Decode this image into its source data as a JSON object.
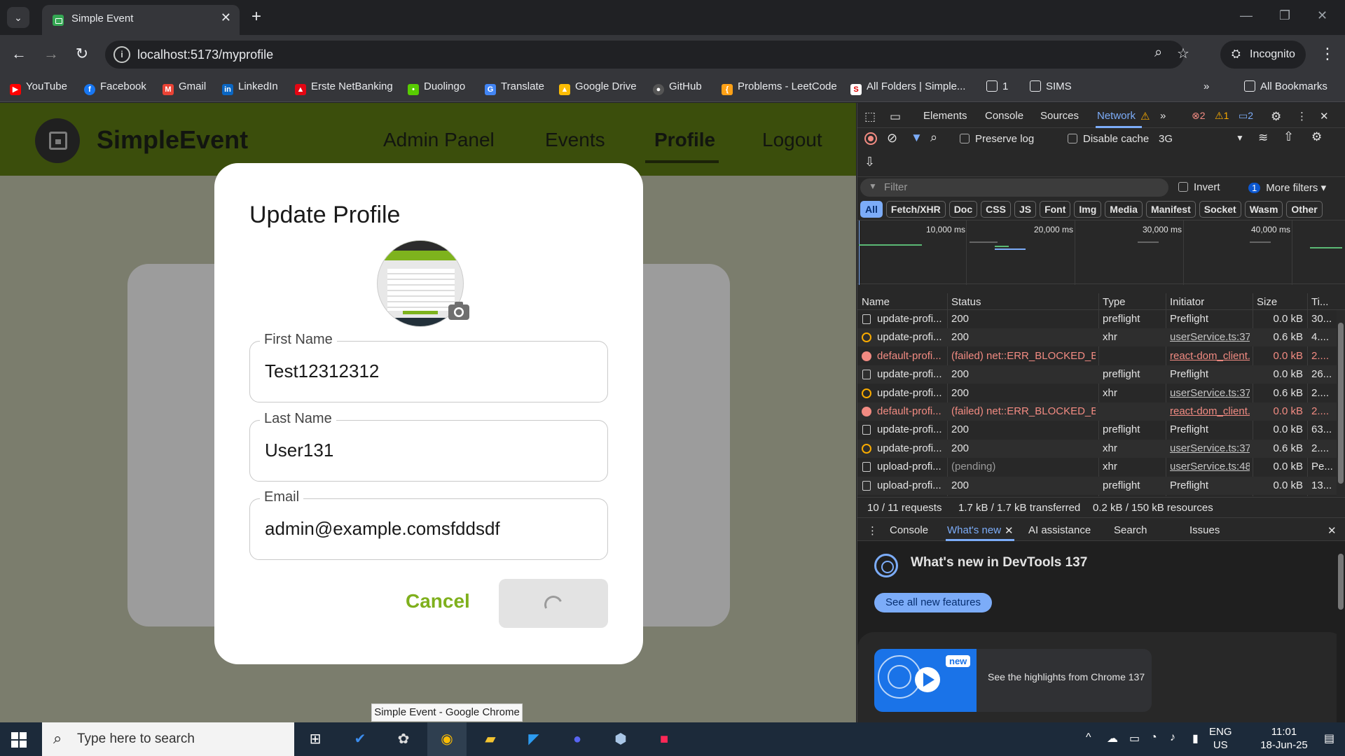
{
  "browser": {
    "tab_title": "Simple Event",
    "url": "localhost:5173/myprofile",
    "incognito_label": "Incognito",
    "bookmarks": [
      "YouTube",
      "Facebook",
      "Gmail",
      "LinkedIn",
      "Erste NetBanking",
      "Duolingo",
      "Translate",
      "Google Drive",
      "GitHub",
      "Problems - LeetCode",
      "All Folders | Simple...",
      "1",
      "SIMS"
    ],
    "all_bookmarks": "All Bookmarks"
  },
  "app": {
    "brand": "SimpleEvent",
    "nav": [
      "Admin Panel",
      "Events",
      "Profile",
      "Logout"
    ],
    "active_nav": "Profile",
    "accent_color": "#7fb01d",
    "header_color": "#3b4e0c"
  },
  "modal": {
    "title": "Update Profile",
    "first_name_label": "First Name",
    "first_name_value": "Test12312312",
    "last_name_label": "Last Name",
    "last_name_value": "User131",
    "email_label": "Email",
    "email_value": "admin@example.comsfddsdf",
    "cancel_label": "Cancel",
    "save_state": "loading"
  },
  "tooltip": "Simple Event - Google Chrome",
  "devtools": {
    "tabs": [
      "Elements",
      "Console",
      "Sources",
      "Network"
    ],
    "active_tab": "Network",
    "errors": "2",
    "warnings": "1",
    "info": "2",
    "preserve_log": "Preserve log",
    "disable_cache": "Disable cache",
    "throttle": "3G",
    "filter_placeholder": "Filter",
    "invert": "Invert",
    "more_filters_count": "1",
    "more_filters": "More filters",
    "type_filters": [
      "All",
      "Fetch/XHR",
      "Doc",
      "CSS",
      "JS",
      "Font",
      "Img",
      "Media",
      "Manifest",
      "Socket",
      "Wasm",
      "Other"
    ],
    "timeline_labels": [
      "10,000 ms",
      "20,000 ms",
      "30,000 ms",
      "40,000 ms"
    ],
    "columns": [
      "Name",
      "Status",
      "Type",
      "Initiator",
      "Size",
      "Ti..."
    ],
    "rows": [
      {
        "icon": "doc",
        "name": "update-profi...",
        "status": "200",
        "type": "preflight",
        "initiator": "Preflight",
        "size": "0.0 kB",
        "time": "30..."
      },
      {
        "icon": "xhr",
        "name": "update-profi...",
        "status": "200",
        "type": "xhr",
        "initiator": "userService.ts:37",
        "size": "0.6 kB",
        "time": "4...."
      },
      {
        "icon": "error",
        "name": "default-profi...",
        "status": "(failed) net::ERR_BLOCKED_B...",
        "type": "",
        "initiator": "react-dom_client.j",
        "size": "0.0 kB",
        "time": "2...."
      },
      {
        "icon": "doc",
        "name": "update-profi...",
        "status": "200",
        "type": "preflight",
        "initiator": "Preflight",
        "size": "0.0 kB",
        "time": "26..."
      },
      {
        "icon": "xhr",
        "name": "update-profi...",
        "status": "200",
        "type": "xhr",
        "initiator": "userService.ts:37",
        "size": "0.6 kB",
        "time": "2...."
      },
      {
        "icon": "error",
        "name": "default-profi...",
        "status": "(failed) net::ERR_BLOCKED_B...",
        "type": "",
        "initiator": "react-dom_client.j",
        "size": "0.0 kB",
        "time": "2...."
      },
      {
        "icon": "doc",
        "name": "update-profi...",
        "status": "200",
        "type": "preflight",
        "initiator": "Preflight",
        "size": "0.0 kB",
        "time": "63..."
      },
      {
        "icon": "xhr",
        "name": "update-profi...",
        "status": "200",
        "type": "xhr",
        "initiator": "userService.ts:37",
        "size": "0.6 kB",
        "time": "2...."
      },
      {
        "icon": "doc",
        "name": "upload-profi...",
        "status": "(pending)",
        "type": "xhr",
        "initiator": "userService.ts:48",
        "size": "0.0 kB",
        "time": "Pe..."
      },
      {
        "icon": "doc",
        "name": "upload-profi...",
        "status": "200",
        "type": "preflight",
        "initiator": "Preflight",
        "size": "0.0 kB",
        "time": "13..."
      }
    ],
    "summary_requests": "10 / 11 requests",
    "summary_transferred": "1.7 kB / 1.7 kB transferred",
    "summary_resources": "0.2 kB / 150 kB resources",
    "drawer_tabs": [
      "Console",
      "What's new",
      "AI assistance",
      "Search",
      "Issues"
    ],
    "drawer_active": "What's new",
    "whats_new_title": "What's new in DevTools 137",
    "see_all": "See all new features",
    "new_badge": "new",
    "highlights": "See the highlights from Chrome 137"
  },
  "taskbar": {
    "search_placeholder": "Type here to search",
    "lang1": "ENG",
    "lang2": "US",
    "time": "11:01",
    "date": "18-Jun-25"
  }
}
